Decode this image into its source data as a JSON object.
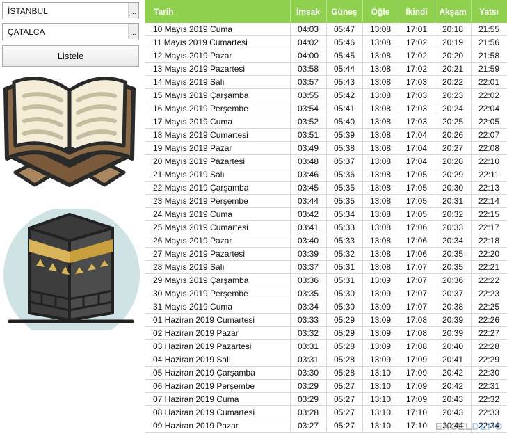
{
  "controls": {
    "city": "İSTANBUL",
    "district": "ÇATALCA",
    "dropdown_glyph": "...",
    "list_button": "Listele"
  },
  "icons": [
    "quran-on-stand-icon",
    "kaaba-icon"
  ],
  "table": {
    "headers": [
      "Tarih",
      "İmsak",
      "Güneş",
      "Öğle",
      "İkindi",
      "Akşam",
      "Yatsı"
    ],
    "header_color": "#8fd14f",
    "rows": [
      [
        "10 Mayıs 2019 Cuma",
        "04:03",
        "05:47",
        "13:08",
        "17:01",
        "20:18",
        "21:55"
      ],
      [
        "11 Mayıs 2019 Cumartesi",
        "04:02",
        "05:46",
        "13:08",
        "17:02",
        "20:19",
        "21:56"
      ],
      [
        "12 Mayıs 2019 Pazar",
        "04:00",
        "05:45",
        "13:08",
        "17:02",
        "20:20",
        "21:58"
      ],
      [
        "13 Mayıs 2019 Pazartesi",
        "03:58",
        "05:44",
        "13:08",
        "17:02",
        "20:21",
        "21:59"
      ],
      [
        "14 Mayıs 2019 Salı",
        "03:57",
        "05:43",
        "13:08",
        "17:03",
        "20:22",
        "22:01"
      ],
      [
        "15 Mayıs 2019 Çarşamba",
        "03:55",
        "05:42",
        "13:08",
        "17:03",
        "20:23",
        "22:02"
      ],
      [
        "16 Mayıs 2019 Perşembe",
        "03:54",
        "05:41",
        "13:08",
        "17:03",
        "20:24",
        "22:04"
      ],
      [
        "17 Mayıs 2019 Cuma",
        "03:52",
        "05:40",
        "13:08",
        "17:03",
        "20:25",
        "22:05"
      ],
      [
        "18 Mayıs 2019 Cumartesi",
        "03:51",
        "05:39",
        "13:08",
        "17:04",
        "20:26",
        "22:07"
      ],
      [
        "19 Mayıs 2019 Pazar",
        "03:49",
        "05:38",
        "13:08",
        "17:04",
        "20:27",
        "22:08"
      ],
      [
        "20 Mayıs 2019 Pazartesi",
        "03:48",
        "05:37",
        "13:08",
        "17:04",
        "20:28",
        "22:10"
      ],
      [
        "21 Mayıs 2019 Salı",
        "03:46",
        "05:36",
        "13:08",
        "17:05",
        "20:29",
        "22:11"
      ],
      [
        "22 Mayıs 2019 Çarşamba",
        "03:45",
        "05:35",
        "13:08",
        "17:05",
        "20:30",
        "22:13"
      ],
      [
        "23 Mayıs 2019 Perşembe",
        "03:44",
        "05:35",
        "13:08",
        "17:05",
        "20:31",
        "22:14"
      ],
      [
        "24 Mayıs 2019 Cuma",
        "03:42",
        "05:34",
        "13:08",
        "17:05",
        "20:32",
        "22:15"
      ],
      [
        "25 Mayıs 2019 Cumartesi",
        "03:41",
        "05:33",
        "13:08",
        "17:06",
        "20:33",
        "22:17"
      ],
      [
        "26 Mayıs 2019 Pazar",
        "03:40",
        "05:33",
        "13:08",
        "17:06",
        "20:34",
        "22:18"
      ],
      [
        "27 Mayıs 2019 Pazartesi",
        "03:39",
        "05:32",
        "13:08",
        "17:06",
        "20:35",
        "22:20"
      ],
      [
        "28 Mayıs 2019 Salı",
        "03:37",
        "05:31",
        "13:08",
        "17:07",
        "20:35",
        "22:21"
      ],
      [
        "29 Mayıs 2019 Çarşamba",
        "03:36",
        "05:31",
        "13:09",
        "17:07",
        "20:36",
        "22:22"
      ],
      [
        "30 Mayıs 2019 Perşembe",
        "03:35",
        "05:30",
        "13:09",
        "17:07",
        "20:37",
        "22:23"
      ],
      [
        "31 Mayıs 2019 Cuma",
        "03:34",
        "05:30",
        "13:09",
        "17:07",
        "20:38",
        "22:25"
      ],
      [
        "01 Haziran 2019 Cumartesi",
        "03:33",
        "05:29",
        "13:09",
        "17:08",
        "20:39",
        "22:26"
      ],
      [
        "02 Haziran 2019 Pazar",
        "03:32",
        "05:29",
        "13:09",
        "17:08",
        "20:39",
        "22:27"
      ],
      [
        "03 Haziran 2019 Pazartesi",
        "03:31",
        "05:28",
        "13:09",
        "17:08",
        "20:40",
        "22:28"
      ],
      [
        "04 Haziran 2019 Salı",
        "03:31",
        "05:28",
        "13:09",
        "17:09",
        "20:41",
        "22:29"
      ],
      [
        "05 Haziran 2019 Çarşamba",
        "03:30",
        "05:28",
        "13:10",
        "17:09",
        "20:42",
        "22:30"
      ],
      [
        "06 Haziran 2019 Perşembe",
        "03:29",
        "05:27",
        "13:10",
        "17:09",
        "20:42",
        "22:31"
      ],
      [
        "07 Haziran 2019 Cuma",
        "03:29",
        "05:27",
        "13:10",
        "17:09",
        "20:43",
        "22:32"
      ],
      [
        "08 Haziran 2019 Cumartesi",
        "03:28",
        "05:27",
        "13:10",
        "17:10",
        "20:43",
        "22:33"
      ],
      [
        "09 Haziran 2019 Pazar",
        "03:27",
        "05:27",
        "13:10",
        "17:10",
        "20:44",
        "22:34"
      ]
    ]
  },
  "watermark": {
    "part1": "EXCEL",
    "part2": "DEPO"
  }
}
